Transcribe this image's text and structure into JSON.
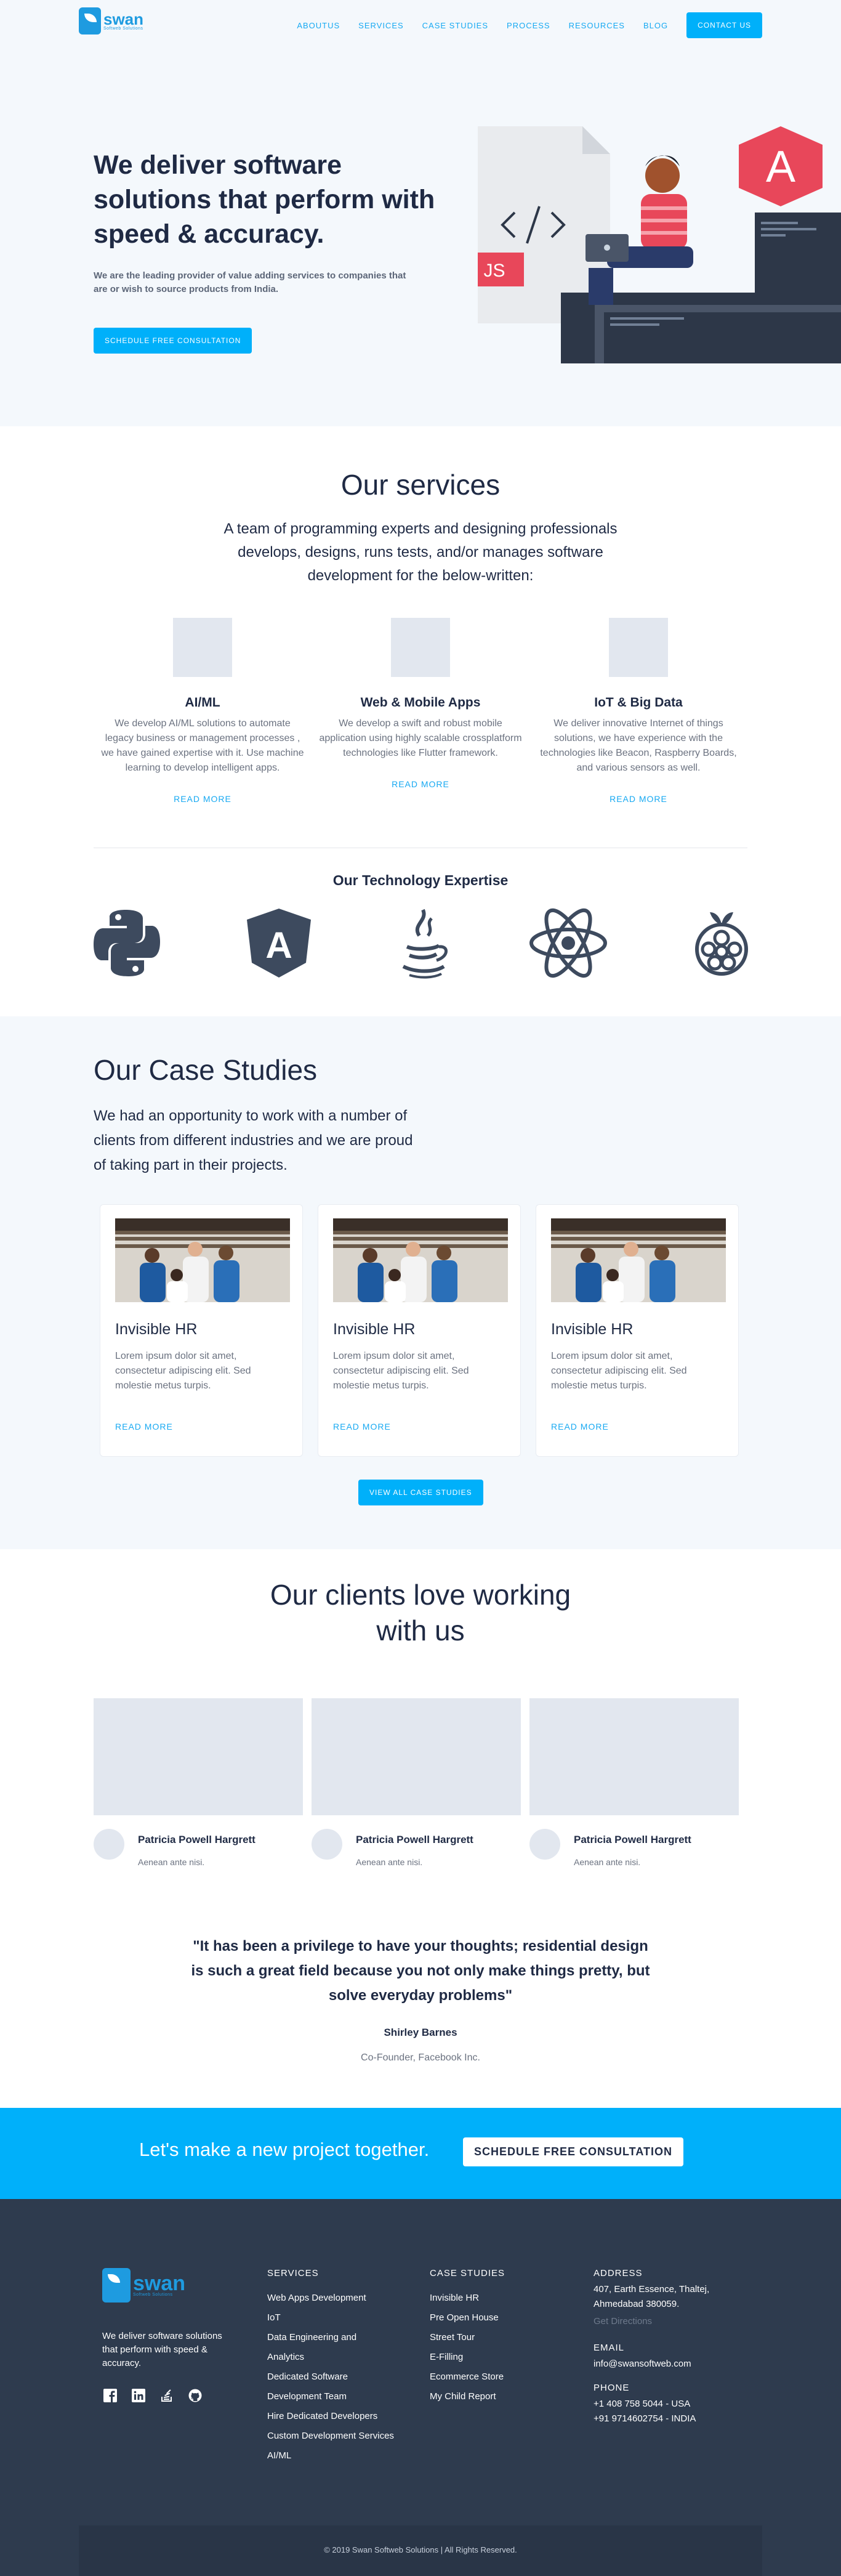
{
  "nav": {
    "logo_text": "swan",
    "logo_sub": "Softweb Solutions",
    "items": [
      "ABOUTUS",
      "SERVICES",
      "CASE STUDIES",
      "PROCESS",
      "RESOURCES",
      "BLOG"
    ],
    "contact": "CONTACT US"
  },
  "hero": {
    "title": "We deliver software solutions that perform with speed & accuracy.",
    "subtitle": "We are the leading provider of value adding services to companies that are or wish to source products from India.",
    "cta": "SCHEDULE FREE CONSULTATION",
    "badge_js": "JS",
    "badge_angular": "A"
  },
  "services": {
    "title": "Our services",
    "description": "A team of programming experts and designing professionals develops, designs, runs tests, and/or manages software development for the below-written:",
    "items": [
      {
        "title": "AI/ML",
        "text": "We develop AI/ML solutions to automate legacy business or management processes , we have gained expertise with it. Use machine learning to develop intelligent apps.",
        "more": "READ MORE"
      },
      {
        "title": "Web & Mobile Apps",
        "text": "We develop a swift and robust mobile application using highly scalable crossplatform technologies like Flutter framework.",
        "more": "READ MORE"
      },
      {
        "title": "IoT & Big Data",
        "text": "We deliver innovative Internet of things solutions, we have experience with the technologies like Beacon, Raspberry Boards, and various sensors as well.",
        "more": "READ MORE"
      }
    ],
    "tech_title": "Our Technology Expertise",
    "tech_icons": [
      "python-icon",
      "angular-icon",
      "java-icon",
      "react-icon",
      "raspberry-pi-icon"
    ],
    "angular_letter": "A"
  },
  "cases": {
    "title": "Our Case Studies",
    "description": "We had an opportunity to work with a number of clients from different industries and we are proud of taking part in their projects.",
    "items": [
      {
        "title": "Invisible HR",
        "text": "Lorem ipsum dolor sit amet, consectetur adipiscing elit. Sed molestie metus turpis.",
        "more": "READ MORE"
      },
      {
        "title": "Invisible HR",
        "text": "Lorem ipsum dolor sit amet, consectetur adipiscing elit. Sed molestie metus turpis.",
        "more": "READ MORE"
      },
      {
        "title": "Invisible HR",
        "text": "Lorem ipsum dolor sit amet, consectetur adipiscing elit. Sed molestie metus turpis.",
        "more": "READ MORE"
      }
    ],
    "view_all": "VIEW ALL CASE STUDIES"
  },
  "clients": {
    "title": "Our clients love working with us",
    "items": [
      {
        "name": "Patricia Powell Hargrett",
        "sub": "Aenean ante nisi."
      },
      {
        "name": "Patricia Powell Hargrett",
        "sub": "Aenean ante nisi."
      },
      {
        "name": "Patricia Powell Hargrett",
        "sub": "Aenean ante nisi."
      }
    ],
    "quote": "\"It has been a privilege to have your thoughts; residential design is such a great field because you not only make things pretty, but solve everyday problems\"",
    "quote_name": "Shirley Barnes",
    "quote_role": "Co-Founder, Facebook Inc."
  },
  "band": {
    "text": "Let's make a new project together.",
    "button": "SCHEDULE FREE CONSULTATION"
  },
  "footer": {
    "logo_text": "swan",
    "logo_sub": "Softweb Solutions",
    "tagline": "We deliver software solutions that perform with speed & accuracy.",
    "social": [
      "facebook-icon",
      "linkedin-icon",
      "stack-overflow-icon",
      "github-icon"
    ],
    "services_title": "SERVICES",
    "services": [
      "Web Apps Development",
      "IoT",
      "Data Engineering and Analytics",
      "Dedicated Software Development Team",
      "Hire Dedicated Developers",
      "Custom Development Services",
      "AI/ML"
    ],
    "cases_title": "CASE STUDIES",
    "cases": [
      "Invisible HR",
      "Pre Open House",
      "Street Tour",
      "E-Filling",
      "Ecommerce Store",
      "My Child Report"
    ],
    "address_title": "ADDRESS",
    "address": "407, Earth Essence, Thaltej, Ahmedabad 380059.",
    "directions": "Get Directions",
    "email_title": "EMAIL",
    "email": "info@swansoftweb.com",
    "phone_title": "PHONE",
    "phone_us": "+1 408 758 5044 - USA",
    "phone_in": "+91 9714602754 - INDIA",
    "copyright": "© 2019 Swan Softweb Solutions | All Rights Reserved."
  },
  "colors": {
    "accent": "#00b0fa",
    "dark": "#1f2a44",
    "footer": "#2e3b4e",
    "hero_bg": "#f4f8fc",
    "red": "#e8475a"
  }
}
